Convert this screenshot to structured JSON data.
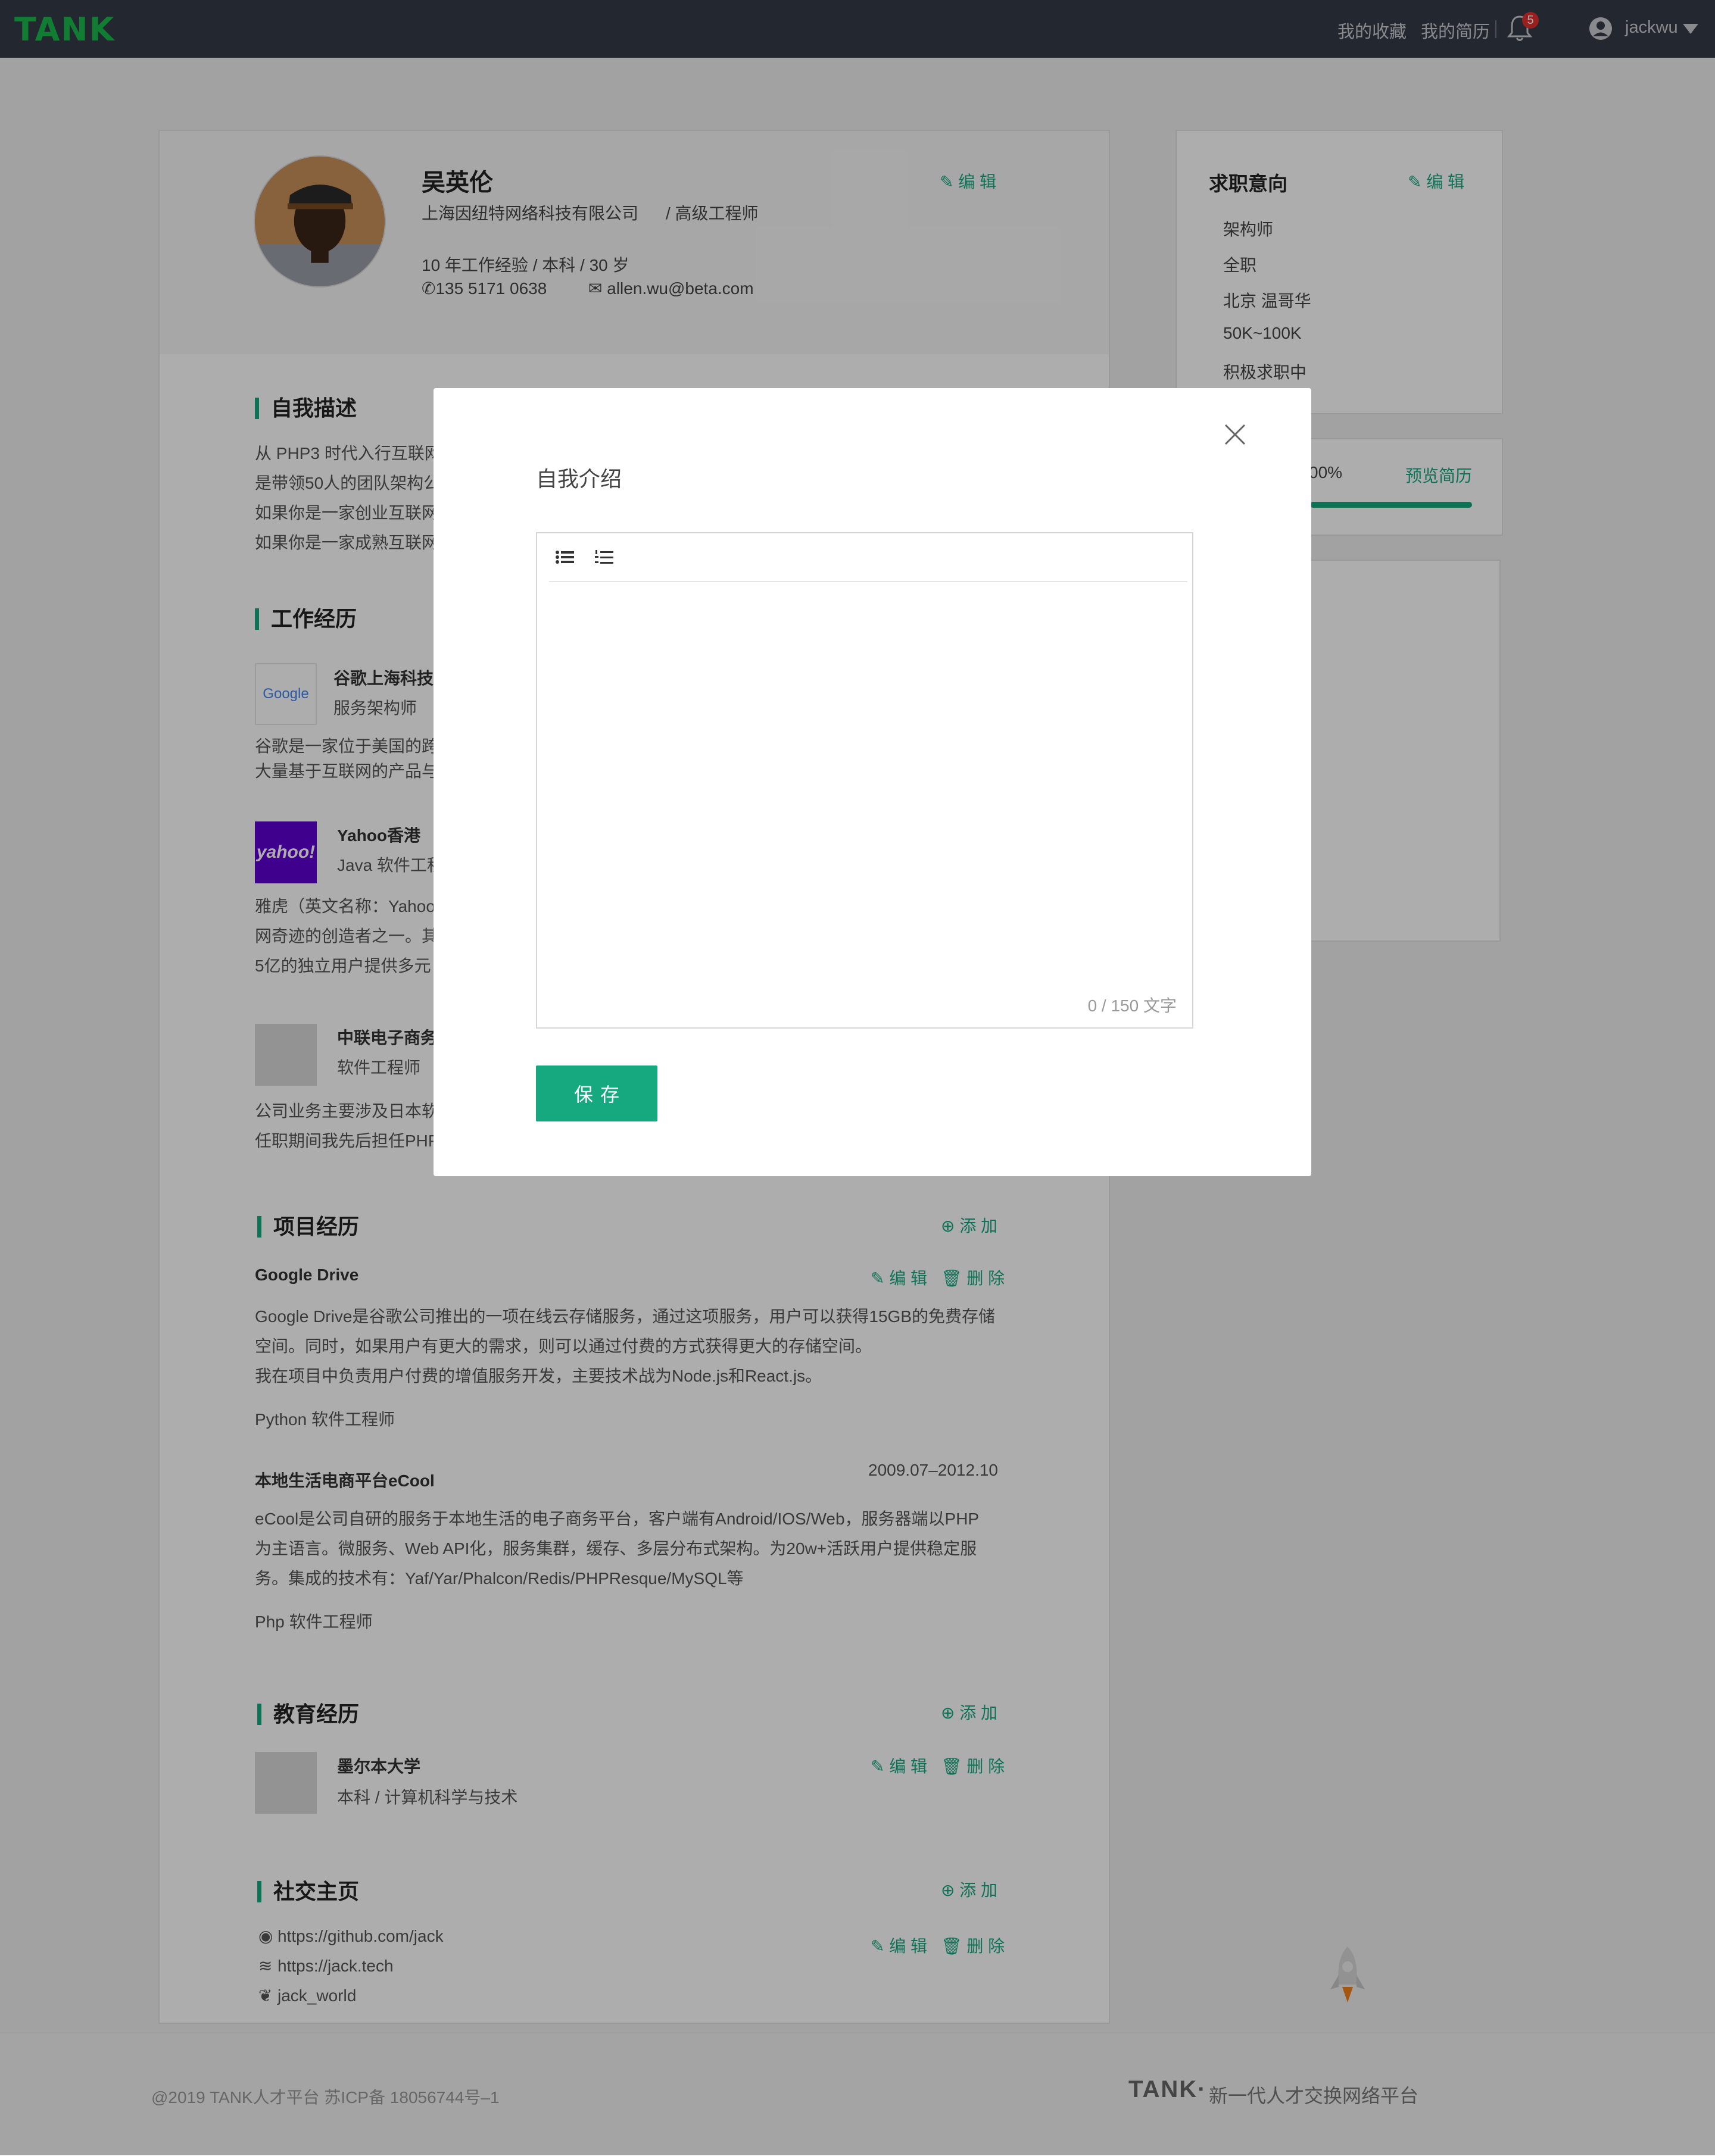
{
  "nav": {
    "logo": "TANK",
    "favorites": "我的收藏",
    "resume": "我的简历",
    "notif_count": "5",
    "username": "jackwu"
  },
  "profile": {
    "name": "吴英伦",
    "company": "上海因纽特网络科技有限公司",
    "position": "/ 高级工程师",
    "edit": "编 辑",
    "meta": "10 年工作经验 / 本科 / 30 岁",
    "phone": "135 5171 0638",
    "email": "allen.wu@beta.com"
  },
  "self_desc": {
    "title": "自我描述",
    "lines": [
      "从 PHP3 时代入行互联网",
      "是带领50人的团队架构公",
      "如果你是一家创业互联网",
      "如果你是一家成熟互联网"
    ]
  },
  "work": {
    "title": "工作经历",
    "items": [
      {
        "logo": "Google",
        "company": "谷歌上海科技",
        "role": "服务架构师",
        "desc": "谷歌是一家位于美国的跨\n大量基于互联网的产品与"
      },
      {
        "logo": "yahoo!",
        "company": "Yahoo香港",
        "role": "Java 软件工程",
        "desc": "雅虎（英文名称：Yahoo\n网奇迹的创造者之一。其\n5亿的独立用户提供多元"
      },
      {
        "logo": "",
        "company": "中联电子商务",
        "role": "软件工程师",
        "desc": "公司业务主要涉及日本软\n任职期间我先后担任PHP"
      }
    ]
  },
  "projects": {
    "title": "项目经历",
    "add": "添 加",
    "edit": "编 辑",
    "delete": "删 除",
    "items": [
      {
        "name": "Google Drive",
        "date": "",
        "desc": "Google Drive是谷歌公司推出的一项在线云存储服务，通过这项服务，用户可以获得15GB的免费存储\n空间。同时，如果用户有更大的需求，则可以通过付费的方式获得更大的存储空间。\n我在项目中负责用户付费的增值服务开发，主要技术战为Node.js和React.js。",
        "role": "Python 软件工程师"
      },
      {
        "name": "本地生活电商平台eCool",
        "date": "2009.07–2012.10",
        "desc": "eCool是公司自研的服务于本地生活的电子商务平台，客户端有Android/IOS/Web，服务器端以PHP\n为主语言。微服务、Web API化，服务集群，缓存、多层分布式架构。为20w+活跃用户提供稳定服\n务。集成的技术有：Yaf/Yar/Phalcon/Redis/PHPResque/MySQL等",
        "role": "Php 软件工程师"
      }
    ]
  },
  "education": {
    "title": "教育经历",
    "add": "添 加",
    "edit": "编 辑",
    "delete": "删 除",
    "school": "墨尔本大学",
    "detail": "本科 / 计算机科学与技术"
  },
  "social": {
    "title": "社交主页",
    "add": "添 加",
    "edit": "编 辑",
    "delete": "删 除",
    "github": "https://github.com/jack",
    "site": "https://jack.tech",
    "wechat": "jack_world"
  },
  "intent": {
    "title": "求职意向",
    "edit": "编 辑",
    "items": [
      "架构师",
      "全职",
      "北京 温哥华",
      "50K~100K",
      "积极求职中"
    ]
  },
  "completion": {
    "percent_text": "00%",
    "progress": 1.0,
    "preview": "预览简历"
  },
  "footer": {
    "copyright": "@2019 TANK人才平台 苏ICP备 18056744号–1",
    "brand": "TANK·",
    "slogan": "新一代人才交换网络平台"
  },
  "modal": {
    "title": "自我介绍",
    "counter": "0 / 150 文字",
    "save": "保存"
  },
  "colors": {
    "accent": "#16a980",
    "nav_bg": "#343b47",
    "logo": "#19b94a"
  }
}
